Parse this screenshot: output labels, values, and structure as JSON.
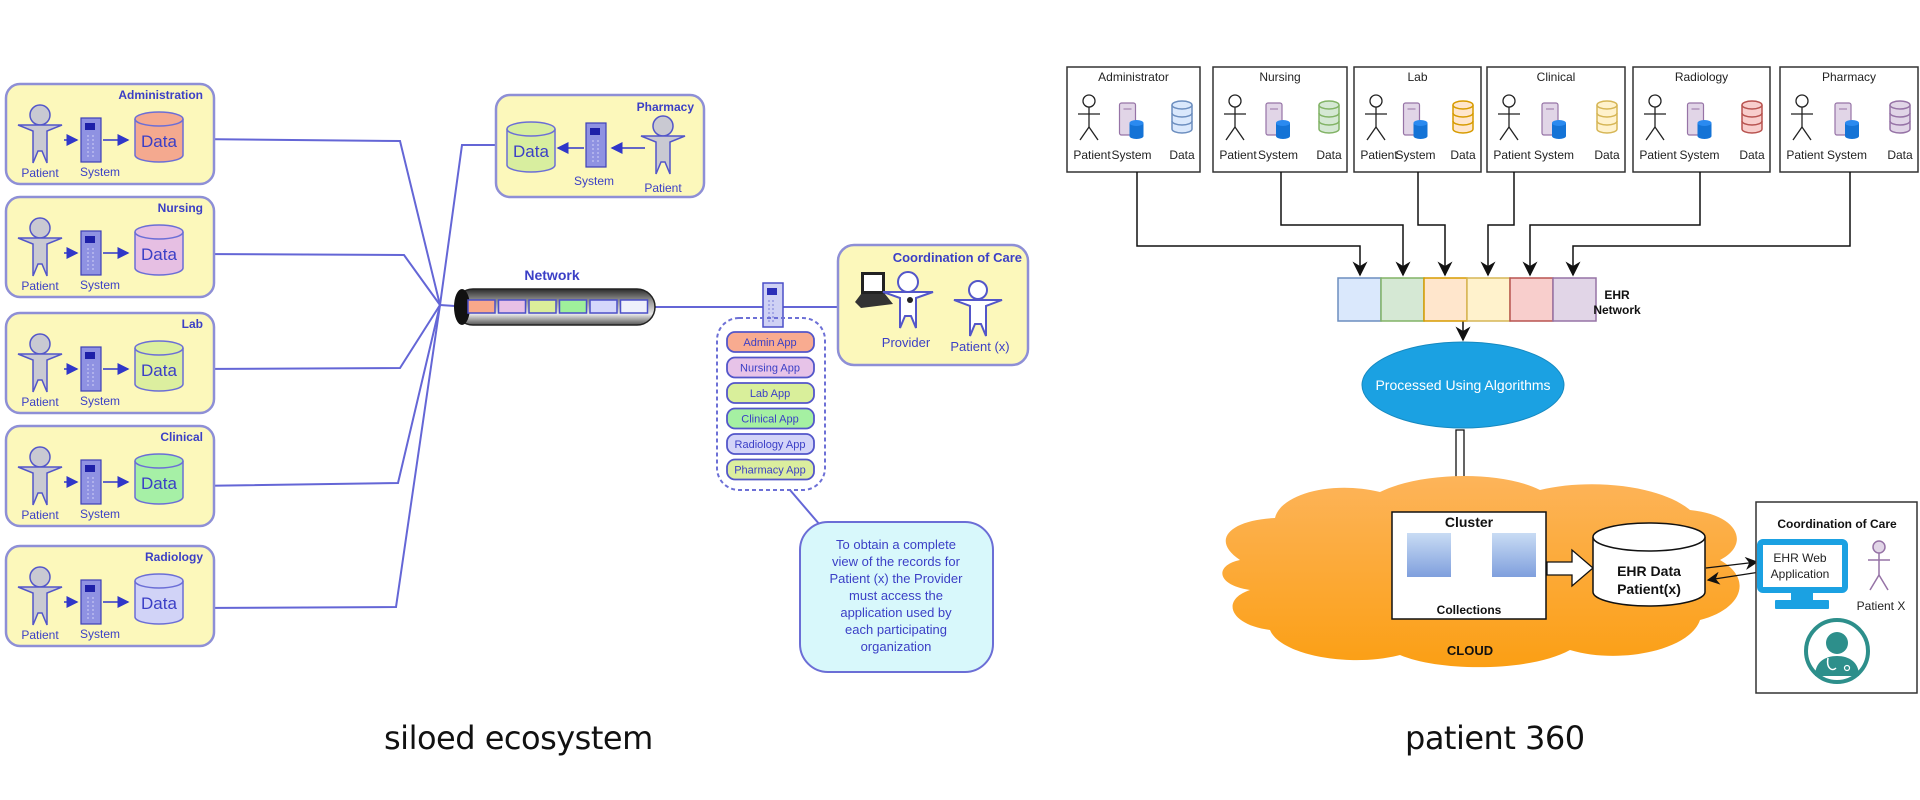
{
  "captions": {
    "left": "siloed ecosystem",
    "right": "patient 360"
  },
  "siloed": {
    "departments": [
      {
        "name": "Administration",
        "patient_label": "Patient",
        "system_label": "System",
        "data_label": "Data",
        "data_color": "#f4a98f"
      },
      {
        "name": "Nursing",
        "patient_label": "Patient",
        "system_label": "System",
        "data_label": "Data",
        "data_color": "#e6bfe3"
      },
      {
        "name": "Lab",
        "patient_label": "Patient",
        "system_label": "System",
        "data_label": "Data",
        "data_color": "#dcef9f"
      },
      {
        "name": "Clinical",
        "patient_label": "Patient",
        "system_label": "System",
        "data_label": "Data",
        "data_color": "#a6f0a6"
      },
      {
        "name": "Radiology",
        "patient_label": "Patient",
        "system_label": "System",
        "data_label": "Data",
        "data_color": "#d1d3f7"
      }
    ],
    "pharmacy": {
      "name": "Pharmacy",
      "patient_label": "Patient",
      "system_label": "System",
      "data_label": "Data",
      "data_color": "#d8ee9f"
    },
    "network_label": "Network",
    "network_segments": [
      "#f9a88a",
      "#e7c0e6",
      "#dbee9a",
      "#9ff09b",
      "#d5d7fb",
      "#eef0fb"
    ],
    "apps": [
      {
        "label": "Admin App",
        "color": "#f8ab90"
      },
      {
        "label": "Nursing App",
        "color": "#e7c3e8"
      },
      {
        "label": "Lab App",
        "color": "#d9ef9b"
      },
      {
        "label": "Clinical App",
        "color": "#a5f0a2"
      },
      {
        "label": "Radiology App",
        "color": "#d3d4f8"
      },
      {
        "label": "Pharmacy App",
        "color": "#dbee9e"
      }
    ],
    "coordination": {
      "title": "Coordination of Care",
      "provider_label": "Provider",
      "patient_label": "Patient (x)"
    },
    "note": [
      "To obtain a complete",
      "view of the records for",
      "Patient (x) the Provider",
      "must access the",
      "application used by",
      "each participating",
      "organization"
    ],
    "colors": {
      "box_fill": "#fcf8bb",
      "box_stroke": "#8e8fd6",
      "text": "#3b3fc6",
      "line": "#5c5fd4"
    }
  },
  "patient360": {
    "departments": [
      {
        "name": "Administrator",
        "patient_label": "Patient",
        "system_label": "System",
        "data_label": "Data",
        "data_color": "#6c8ebf",
        "data_fill": "#dae8fc"
      },
      {
        "name": "Nursing",
        "patient_label": "Patient",
        "system_label": "System",
        "data_label": "Data",
        "data_color": "#82b366",
        "data_fill": "#d5e8d4"
      },
      {
        "name": "Lab",
        "patient_label": "Patient",
        "system_label": "System",
        "data_label": "Data",
        "data_color": "#d79b00",
        "data_fill": "#ffe6cc"
      },
      {
        "name": "Clinical",
        "patient_label": "Patient",
        "system_label": "System",
        "data_label": "Data",
        "data_color": "#d6b656",
        "data_fill": "#fff2cc"
      },
      {
        "name": "Radiology",
        "patient_label": "Patient",
        "system_label": "System",
        "data_label": "Data",
        "data_color": "#b85450",
        "data_fill": "#f8cecc"
      },
      {
        "name": "Pharmacy",
        "patient_label": "Patient",
        "system_label": "System",
        "data_label": "Data",
        "data_color": "#9673a6",
        "data_fill": "#e1d5e7"
      }
    ],
    "network_label_line1": "EHR",
    "network_label_line2": "Network",
    "processing_label": "Processed Using Algorithms",
    "cluster_title": "Cluster",
    "cluster_footer": "Collections",
    "cloud_label": "CLOUD",
    "ehr_data_line1": "EHR Data",
    "ehr_data_line2": "Patient(x)",
    "coordination": {
      "title": "Coordination of Care",
      "app_line1": "EHR Web",
      "app_line2": "Application",
      "patient_label": "Patient X"
    },
    "colors": {
      "ellipse": "#1ba1e2",
      "cloud": "#ffa621",
      "monitor": "#1ba1e2",
      "doctor": "#2d8f8b"
    }
  }
}
